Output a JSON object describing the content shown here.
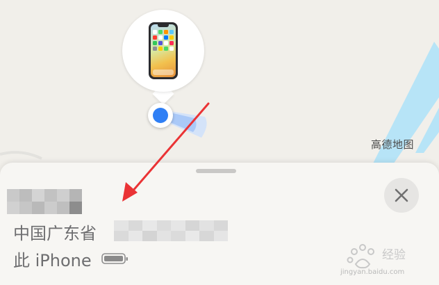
{
  "map": {
    "attribution": "高德地图"
  },
  "device_bubble": {
    "icon": "iphone-icon"
  },
  "bottom_sheet": {
    "address_prefix": "中国广东省",
    "device_name": "此 iPhone",
    "close_icon": "close-icon",
    "battery_icon": "battery-icon"
  },
  "colors": {
    "location_dot": "#2f7ff5",
    "annotation_arrow": "#ea3335",
    "road": "#b7e4f7"
  },
  "watermark": {
    "text": "jingyan.baidu.com"
  }
}
